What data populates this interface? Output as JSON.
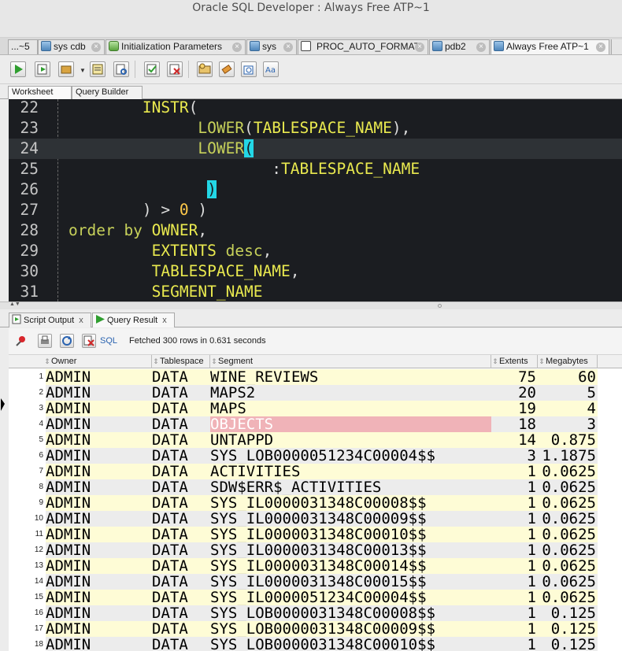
{
  "window": {
    "title": "Oracle SQL Developer : Always Free ATP~1"
  },
  "tabs": [
    {
      "label": "...~5",
      "icon": "sql-connection-icon"
    },
    {
      "label": "sys cdb",
      "icon": "sql-connection-icon"
    },
    {
      "label": "Initialization Parameters",
      "icon": "parameters-icon"
    },
    {
      "label": "sys",
      "icon": "sql-connection-icon"
    },
    {
      "label": "PROC_AUTO_FORMAT",
      "icon": "procedure-icon"
    },
    {
      "label": "pdb2",
      "icon": "sql-connection-icon"
    },
    {
      "label": "Always Free ATP~1",
      "icon": "sql-connection-icon",
      "active": true
    }
  ],
  "toolbar": {
    "buttons": [
      "run-statement-icon",
      "run-script-icon",
      "commit-icon",
      "explain-plan-icon",
      "autotrace-icon",
      "commit-transaction-icon",
      "rollback-icon",
      "sql-tuning-icon",
      "clear-icon",
      "history-icon",
      "format-case-icon"
    ]
  },
  "subtabs": {
    "worksheet": "Worksheet",
    "query_builder": "Query Builder"
  },
  "editor": {
    "lines": [
      {
        "num": "22",
        "tokens": [
          [
            "id",
            "        INSTR"
          ],
          [
            "pu",
            "("
          ]
        ]
      },
      {
        "num": "23",
        "tokens": [
          [
            "kw",
            "              LOWER"
          ],
          [
            "pu",
            "("
          ],
          [
            "id",
            "TABLESPACE_NAME"
          ],
          [
            "pu",
            "),"
          ]
        ]
      },
      {
        "num": "24",
        "tokens": [
          [
            "kw",
            "              LOWER"
          ],
          [
            "bm",
            "("
          ]
        ],
        "current": true
      },
      {
        "num": "25",
        "tokens": [
          [
            "pu",
            "                      :"
          ],
          [
            "id",
            "TABLESPACE_NAME"
          ]
        ]
      },
      {
        "num": "26",
        "tokens": [
          [
            "pu",
            "               "
          ],
          [
            "bm",
            ")"
          ]
        ]
      },
      {
        "num": "27",
        "tokens": [
          [
            "pu",
            "        ) > "
          ],
          [
            "nm",
            "0"
          ],
          [
            "pu",
            " )"
          ]
        ]
      },
      {
        "num": "28",
        "tokens": [
          [
            "kw",
            "order by "
          ],
          [
            "id",
            "OWNER"
          ],
          [
            "pu",
            ","
          ]
        ]
      },
      {
        "num": "29",
        "tokens": [
          [
            "id",
            "         EXTENTS "
          ],
          [
            "kw",
            "desc"
          ],
          [
            "pu",
            ","
          ]
        ]
      },
      {
        "num": "30",
        "tokens": [
          [
            "id",
            "         TABLESPACE_NAME"
          ],
          [
            "pu",
            ","
          ]
        ]
      },
      {
        "num": "31",
        "tokens": [
          [
            "id",
            "         SEGMENT_NAME"
          ]
        ]
      }
    ]
  },
  "results": {
    "tabs": {
      "script_output": "Script Output",
      "query_result": "Query Result",
      "close": "x"
    },
    "sql_link": "SQL",
    "status": "Fetched 300 rows in 0.631 seconds",
    "columns": [
      "Owner",
      "Tablespace",
      "Segment",
      "Extents",
      "Megabytes"
    ],
    "rows": [
      {
        "n": "1",
        "owner": "ADMIN",
        "ts": "DATA",
        "seg": "WINE_REVIEWS",
        "ext": "75",
        "mb": "60"
      },
      {
        "n": "2",
        "owner": "ADMIN",
        "ts": "DATA",
        "seg": "MAPS2",
        "ext": "20",
        "mb": "5"
      },
      {
        "n": "3",
        "owner": "ADMIN",
        "ts": "DATA",
        "seg": "MAPS",
        "ext": "19",
        "mb": "4"
      },
      {
        "n": "4",
        "owner": "ADMIN",
        "ts": "DATA",
        "seg": "OBJECTS",
        "ext": "18",
        "mb": "3",
        "selected": true
      },
      {
        "n": "5",
        "owner": "ADMIN",
        "ts": "DATA",
        "seg": "UNTAPPD",
        "ext": "14",
        "mb": "0.875"
      },
      {
        "n": "6",
        "owner": "ADMIN",
        "ts": "DATA",
        "seg": "SYS_LOB0000051234C00004$$",
        "ext": "3",
        "mb": "1.1875"
      },
      {
        "n": "7",
        "owner": "ADMIN",
        "ts": "DATA",
        "seg": "ACTIVITIES",
        "ext": "1",
        "mb": "0.0625"
      },
      {
        "n": "8",
        "owner": "ADMIN",
        "ts": "DATA",
        "seg": "SDW$ERR$_ACTIVITIES",
        "ext": "1",
        "mb": "0.0625"
      },
      {
        "n": "9",
        "owner": "ADMIN",
        "ts": "DATA",
        "seg": "SYS_IL0000031348C00008$$",
        "ext": "1",
        "mb": "0.0625"
      },
      {
        "n": "10",
        "owner": "ADMIN",
        "ts": "DATA",
        "seg": "SYS_IL0000031348C00009$$",
        "ext": "1",
        "mb": "0.0625"
      },
      {
        "n": "11",
        "owner": "ADMIN",
        "ts": "DATA",
        "seg": "SYS_IL0000031348C00010$$",
        "ext": "1",
        "mb": "0.0625"
      },
      {
        "n": "12",
        "owner": "ADMIN",
        "ts": "DATA",
        "seg": "SYS_IL0000031348C00013$$",
        "ext": "1",
        "mb": "0.0625"
      },
      {
        "n": "13",
        "owner": "ADMIN",
        "ts": "DATA",
        "seg": "SYS_IL0000031348C00014$$",
        "ext": "1",
        "mb": "0.0625"
      },
      {
        "n": "14",
        "owner": "ADMIN",
        "ts": "DATA",
        "seg": "SYS_IL0000031348C00015$$",
        "ext": "1",
        "mb": "0.0625"
      },
      {
        "n": "15",
        "owner": "ADMIN",
        "ts": "DATA",
        "seg": "SYS_IL0000051234C00004$$",
        "ext": "1",
        "mb": "0.0625"
      },
      {
        "n": "16",
        "owner": "ADMIN",
        "ts": "DATA",
        "seg": "SYS_LOB0000031348C00008$$",
        "ext": "1",
        "mb": "0.125"
      },
      {
        "n": "17",
        "owner": "ADMIN",
        "ts": "DATA",
        "seg": "SYS_LOB0000031348C00009$$",
        "ext": "1",
        "mb": "0.125"
      },
      {
        "n": "18",
        "owner": "ADMIN",
        "ts": "DATA",
        "seg": "SYS_LOB0000031348C00010$$",
        "ext": "1",
        "mb": "0.125"
      }
    ]
  }
}
